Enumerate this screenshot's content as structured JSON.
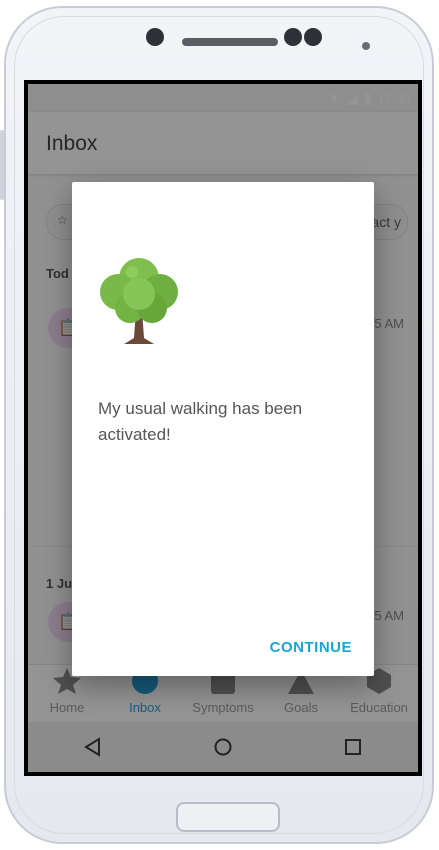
{
  "status_bar": {
    "time": "12:30"
  },
  "app_bar": {
    "title": "Inbox"
  },
  "filter_chip": {
    "text": "ntact y"
  },
  "sections": [
    {
      "label": "Tod",
      "message_time": "5 AM"
    },
    {
      "label": "1 Ju",
      "message_time": "5 AM"
    }
  ],
  "bottom_nav": {
    "items": [
      {
        "label": "Home",
        "icon": "star-icon"
      },
      {
        "label": "Inbox",
        "icon": "inbox-circle-icon"
      },
      {
        "label": "Symptoms",
        "icon": "symptoms-square-icon"
      },
      {
        "label": "Goals",
        "icon": "goals-triangle-icon"
      },
      {
        "label": "Education",
        "icon": "education-hexagon-icon"
      }
    ],
    "active": "Inbox"
  },
  "dialog": {
    "illustration": "tree-icon",
    "message": "My usual walking has been activated!",
    "continue_label": "CONTINUE"
  },
  "colors": {
    "accent": "#2a9fd6",
    "continue": "#1aa3d6",
    "chip_icon_bg": "#f1d8f5",
    "system_nav": "#8b8b8b"
  }
}
